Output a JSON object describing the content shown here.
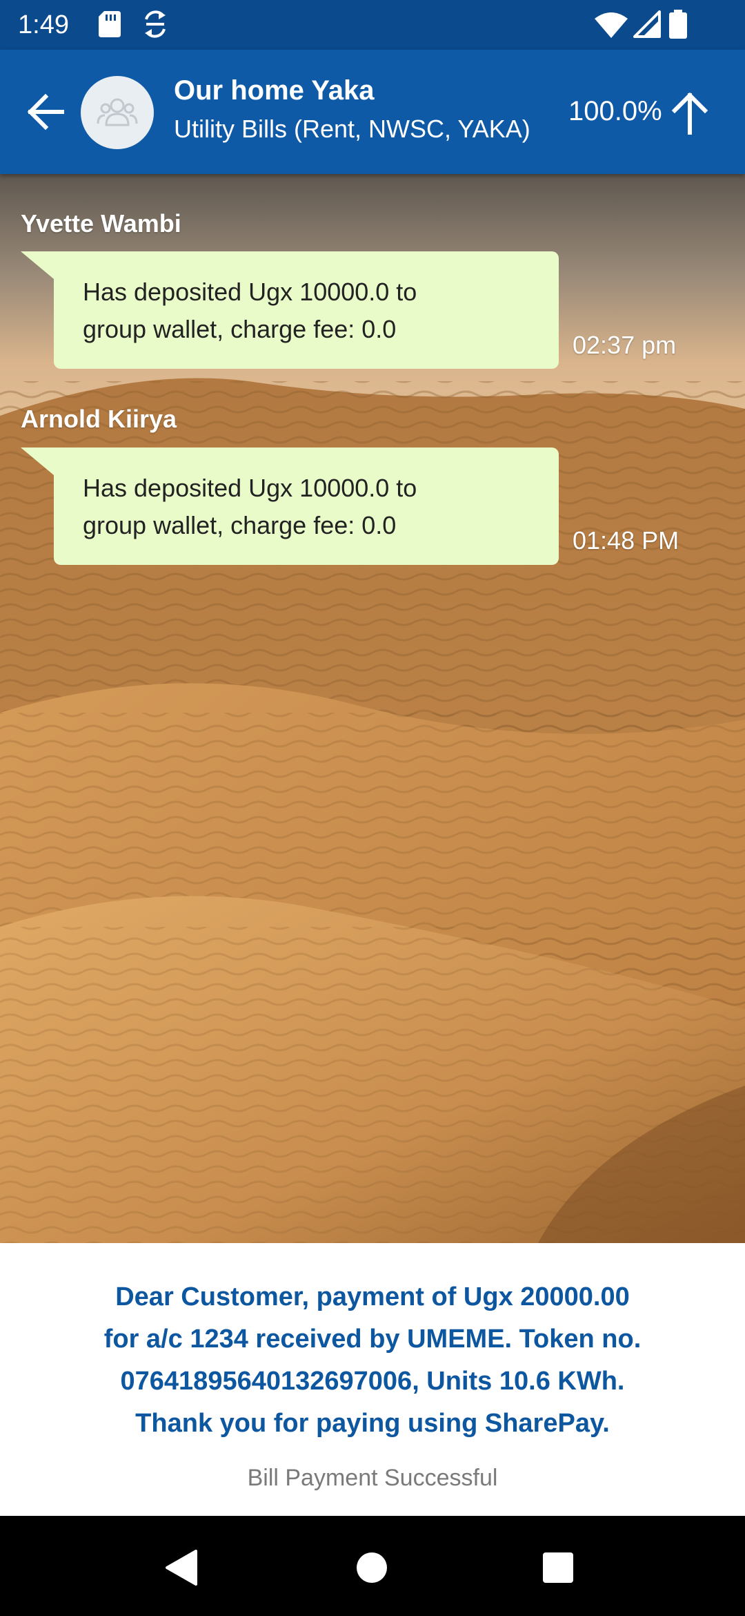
{
  "status_bar": {
    "time": "1:49",
    "icons": [
      "sd-card-icon",
      "sync-icon",
      "wifi-icon",
      "signal-icon",
      "battery-icon"
    ]
  },
  "header": {
    "group_name": "Our home Yaka",
    "group_subtitle": "Utility Bills (Rent, NWSC, YAKA)",
    "progress": "100.0%",
    "icons": [
      "back-arrow-icon",
      "group-avatar-icon",
      "arrow-up-icon"
    ]
  },
  "messages": [
    {
      "sender": "Yvette  Wambi",
      "line1": "Has deposited Ugx 10000.0 to",
      "line2": "group wallet, charge fee: 0.0",
      "time": "02:37 pm"
    },
    {
      "sender": "Arnold Kiirya",
      "line1": "Has deposited Ugx 10000.0 to",
      "line2": "group wallet, charge fee: 0.0",
      "time": "01:48 PM"
    }
  ],
  "payment": {
    "line1": "Dear Customer, payment of Ugx 20000.00",
    "line2": "for a/c 1234 received by UMEME. Token no.",
    "line3": "07641895640132697006, Units 10.6 KWh.",
    "line4": "Thank you for paying using SharePay.",
    "status": "Bill Payment Successful"
  },
  "nav_bar": {
    "icons": [
      "nav-back-icon",
      "nav-home-icon",
      "nav-recents-icon"
    ]
  },
  "colors": {
    "status_bar": "#0b4a8d",
    "app_bar": "#0e5aa7",
    "bubble": "#e9fbc9",
    "payment_text": "#0d56a0",
    "status_text": "#7a7a7a"
  }
}
